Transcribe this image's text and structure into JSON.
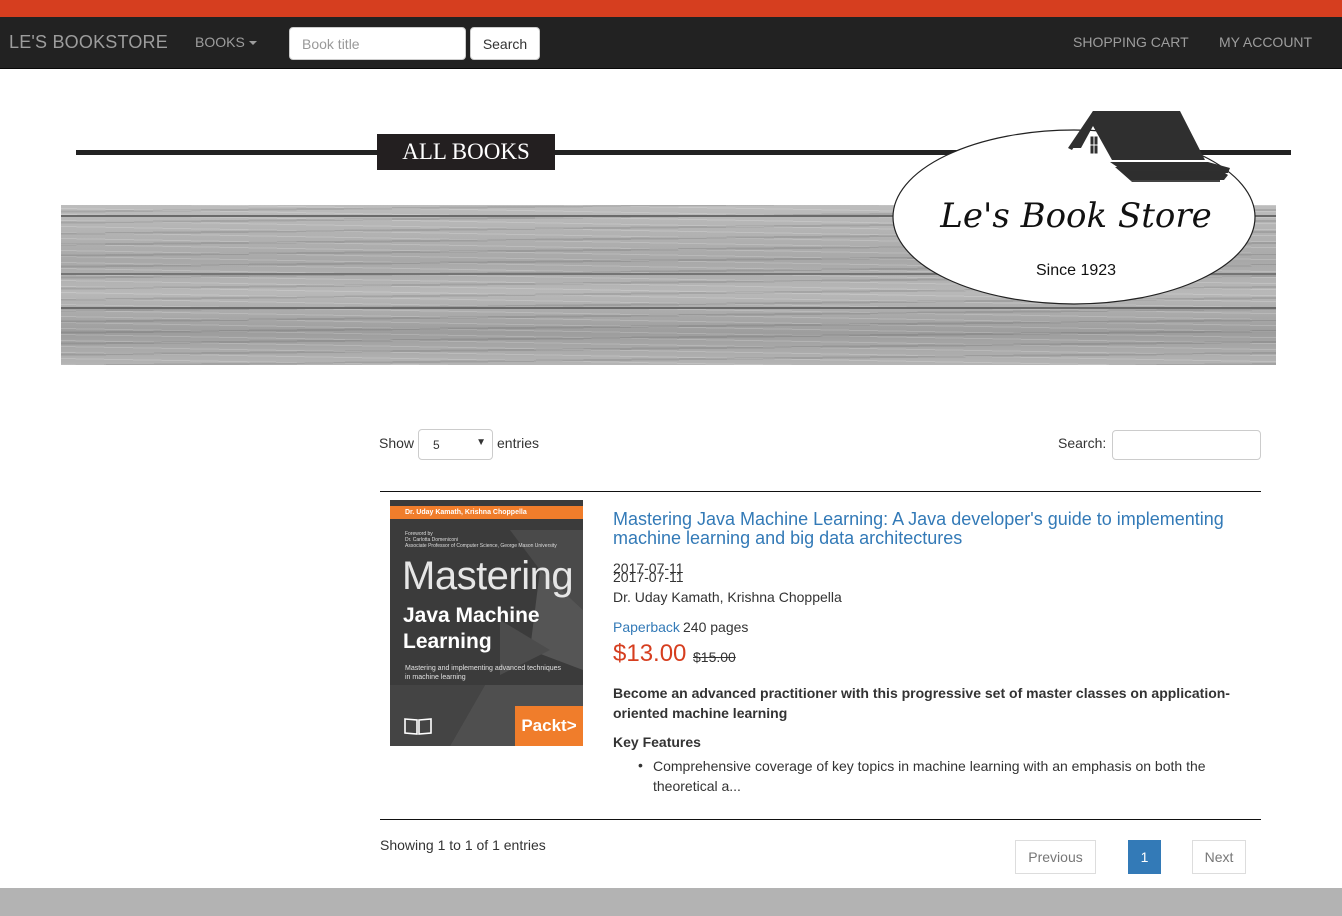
{
  "colors": {
    "accent_strip": "#d63e1f",
    "navbar_bg": "#222222",
    "nav_text": "#9d9d9d",
    "link_blue": "#337ab7",
    "price_red": "#d63e1f",
    "footer_gray": "#b3b3b3"
  },
  "navbar": {
    "brand": "LE'S BOOKSTORE",
    "books_menu": "BOOKS",
    "search_placeholder": "Book title",
    "search_button": "Search",
    "cart": "SHOPPING CART",
    "account": "MY ACCOUNT"
  },
  "banner": {
    "heading": "ALL BOOKS",
    "logo_name": "Le's Book Store",
    "logo_since": "Since 1923"
  },
  "table_controls": {
    "show_label": "Show",
    "page_length": "5",
    "entries_label": "entries",
    "search_label": "Search:",
    "search_value": ""
  },
  "book": {
    "title": "Mastering Java Machine Learning: A Java developer's guide to implementing machine learning and big data architectures",
    "date": "2017-07-11",
    "authors": "Dr. Uday Kamath, Krishna Choppella",
    "format": "Paperback",
    "pages": "240 pages",
    "price": "$13.00",
    "original_price": "$15.00",
    "summary": "Become an advanced practitioner with this progressive set of master classes on application-oriented machine learning",
    "key_features_heading": "Key Features",
    "key_features": [
      "Comprehensive coverage of key topics in machine learning with an emphasis on both the theoretical a..."
    ],
    "cover": {
      "authors_band": "Dr. Uday Kamath, Krishna Choppella",
      "foreword_line1": "Foreword by",
      "foreword_line2": "Dr. Carlotta Domeniconi",
      "foreword_line3": "Associate Professor of Computer Science, George Mason University",
      "title_word": "Mastering",
      "title_rest": "Java Machine Learning",
      "subtitle": "Mastering and implementing advanced techniques in machine learning",
      "publisher": "Packt>"
    }
  },
  "footer_info": {
    "showing": "Showing 1 to 1 of 1 entries"
  },
  "pagination": {
    "previous": "Previous",
    "current_page": "1",
    "next": "Next"
  }
}
